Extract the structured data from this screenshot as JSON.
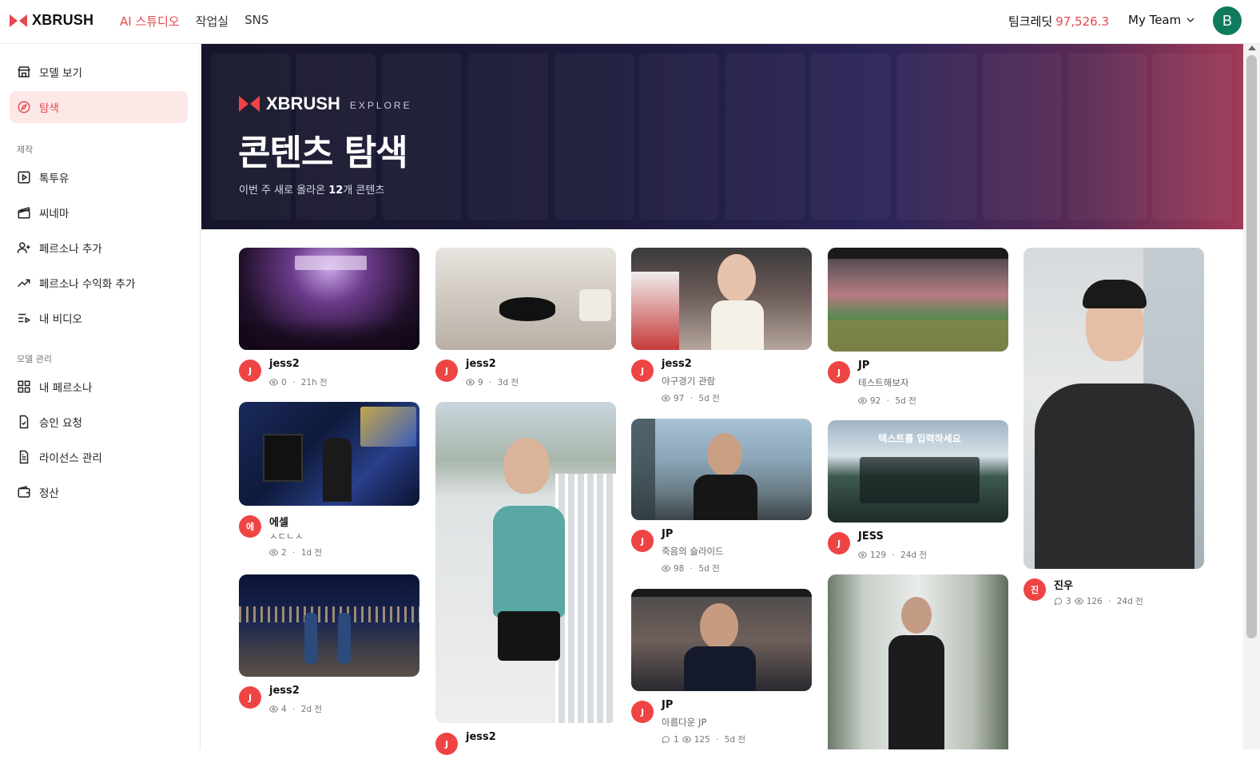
{
  "header": {
    "brand": "XBRUSH",
    "nav": [
      "AI 스튜디오",
      "작업실",
      "SNS"
    ],
    "credits_label": "팀크레딧",
    "credits_value": "97,526.3",
    "team_label": "My Team",
    "user_initial": "B"
  },
  "sidebar": {
    "top_items": [
      {
        "label": "모델 보기",
        "icon": "store-icon"
      },
      {
        "label": "탐색",
        "icon": "compass-icon"
      }
    ],
    "section_make": "제작",
    "make_items": [
      {
        "label": "톡투유",
        "icon": "play-icon"
      },
      {
        "label": "씨네마",
        "icon": "clapper-icon"
      },
      {
        "label": "페르소나 추가",
        "icon": "user-plus-icon"
      },
      {
        "label": "페르소나 수익화 추가",
        "icon": "trending-icon"
      },
      {
        "label": "내 비디오",
        "icon": "list-video-icon"
      }
    ],
    "section_manage": "모델 관리",
    "manage_items": [
      {
        "label": "내 페르소나",
        "icon": "grid-icon"
      },
      {
        "label": "승인 요청",
        "icon": "file-check-icon"
      },
      {
        "label": "라이선스 관리",
        "icon": "file-text-icon"
      },
      {
        "label": "정산",
        "icon": "wallet-icon"
      }
    ]
  },
  "hero": {
    "brand": "XBRUSH",
    "tag": "EXPLORE",
    "title": "콘텐츠 탐색",
    "sub_prefix": "이번 주 새로 올라온 ",
    "sub_count": "12",
    "sub_suffix": "개 콘텐츠"
  },
  "cards": [
    {
      "id": "c1",
      "avatar": "J",
      "name": "jess2",
      "desc": "",
      "comments": "",
      "views": "0",
      "age": "21h 전",
      "thumb_caption": ""
    },
    {
      "id": "c2",
      "avatar": "J",
      "name": "jess2",
      "desc": "",
      "comments": "",
      "views": "9",
      "age": "3d 전",
      "thumb_caption": ""
    },
    {
      "id": "c3",
      "avatar": "J",
      "name": "jess2",
      "desc": "야구경기 관람",
      "comments": "",
      "views": "97",
      "age": "5d 전",
      "thumb_caption": ""
    },
    {
      "id": "c4",
      "avatar": "J",
      "name": "JP",
      "desc": "테스트해보자",
      "comments": "",
      "views": "92",
      "age": "5d 전",
      "thumb_caption": ""
    },
    {
      "id": "c5",
      "avatar": "진",
      "name": "진우",
      "desc": "",
      "comments": "3",
      "views": "126",
      "age": "24d 전",
      "thumb_caption": ""
    },
    {
      "id": "c6",
      "avatar": "에",
      "name": "에셀",
      "desc": "ㅅㄷㄴㅅ",
      "comments": "",
      "views": "2",
      "age": "1d 전",
      "thumb_caption": ""
    },
    {
      "id": "c7",
      "avatar": "J",
      "name": "jess2",
      "desc": "",
      "comments": "",
      "views": "",
      "age": "",
      "thumb_caption": ""
    },
    {
      "id": "c8",
      "avatar": "J",
      "name": "JP",
      "desc": "죽음의 슬라이드",
      "comments": "",
      "views": "98",
      "age": "5d 전",
      "thumb_caption": ""
    },
    {
      "id": "c9",
      "avatar": "J",
      "name": "JESS",
      "desc": "",
      "comments": "",
      "views": "129",
      "age": "24d 전",
      "thumb_caption": "텍스트를 입력하세요"
    },
    {
      "id": "c10",
      "avatar": "J",
      "name": "jess2",
      "desc": "",
      "comments": "",
      "views": "4",
      "age": "2d 전",
      "thumb_caption": ""
    },
    {
      "id": "c11",
      "avatar": "J",
      "name": "JP",
      "desc": "아름다운 JP",
      "comments": "1",
      "views": "125",
      "age": "5d 전",
      "thumb_caption": ""
    }
  ],
  "colors": {
    "accent": "#e5484d",
    "avatar_red": "#ef4444",
    "user_avatar": "#0f7a5c"
  }
}
